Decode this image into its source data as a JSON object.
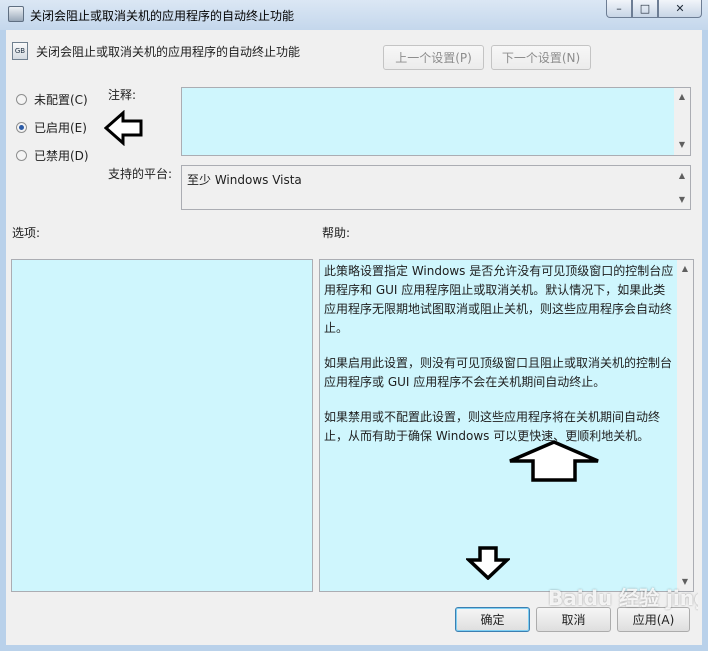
{
  "window": {
    "title": "关闭会阻止或取消关机的应用程序的自动终止功能",
    "buttons": {
      "minimize": "–",
      "maximize": "□",
      "close": "✕"
    }
  },
  "header": {
    "title": "关闭会阻止或取消关机的应用程序的自动终止功能",
    "prev_setting": "上一个设置(P)",
    "next_setting": "下一个设置(N)"
  },
  "state": {
    "options": [
      {
        "label": "未配置(C)",
        "selected": false
      },
      {
        "label": "已启用(E)",
        "selected": true
      },
      {
        "label": "已禁用(D)",
        "selected": false
      }
    ]
  },
  "comment": {
    "label": "注释:",
    "value": ""
  },
  "platform": {
    "label": "支持的平台:",
    "value": "至少 Windows Vista"
  },
  "options_pane": {
    "label": "选项:"
  },
  "help_pane": {
    "label": "帮助:",
    "paragraphs": [
      "此策略设置指定 Windows 是否允许没有可见顶级窗口的控制台应用程序和 GUI 应用程序阻止或取消关机。默认情况下，如果此类应用程序无限期地试图取消或阻止关机，则这些应用程序会自动终止。",
      "如果启用此设置，则没有可见顶级窗口且阻止或取消关机的控制台应用程序或 GUI 应用程序不会在关机期间自动终止。",
      "如果禁用或不配置此设置，则这些应用程序将在关机期间自动终止，从而有助于确保 Windows 可以更快速、更顺利地关机。"
    ]
  },
  "footer": {
    "ok": "确定",
    "cancel": "取消",
    "apply": "应用(A)"
  },
  "watermark": "Baidu 经验 jingyan.baidu.com",
  "colors": {
    "pane_bg": "#cff6fd",
    "dialog_bg": "#f0f0f0",
    "titlebar": "#c4d7ec"
  },
  "icons": [
    "policy-icon",
    "minimize-icon",
    "maximize-icon",
    "close-icon",
    "annotation-left-arrow",
    "annotation-up-arrow",
    "annotation-down-arrow"
  ]
}
